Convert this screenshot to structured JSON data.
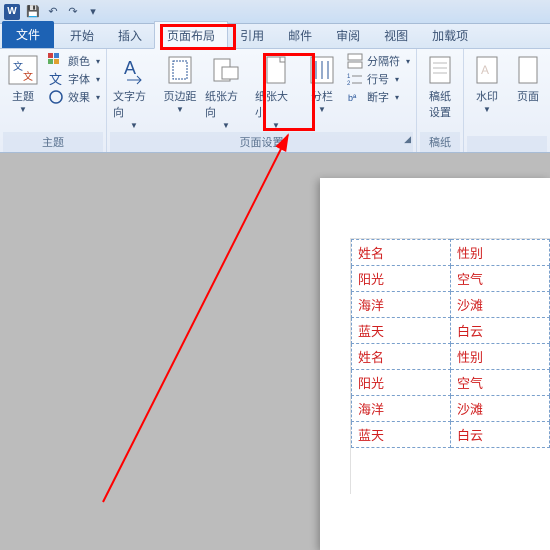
{
  "qat": {
    "save": "💾",
    "undo": "↶",
    "redo": "↷"
  },
  "tabs": {
    "file": "文件",
    "items": [
      "开始",
      "插入",
      "页面布局",
      "引用",
      "邮件",
      "审阅",
      "视图",
      "加载项"
    ],
    "active_index": 2
  },
  "ribbon": {
    "theme": {
      "label": "主题",
      "theme_btn": "主题",
      "color": "颜色",
      "font": "字体",
      "effect": "效果"
    },
    "page_setup": {
      "label": "页面设置",
      "text_dir": "文字方向",
      "margins": "页边距",
      "orientation": "纸张方向",
      "size": "纸张大小",
      "columns": "分栏",
      "breaks": "分隔符",
      "line_no": "行号",
      "hyphen": "断字"
    },
    "draft": {
      "label": "稿纸",
      "btn": "稿纸",
      "btn2": "设置"
    },
    "watermark": {
      "btn": "水印"
    },
    "page_bg": {
      "btn": "页面"
    }
  },
  "table": {
    "rows": [
      [
        "姓名",
        "性别"
      ],
      [
        "阳光",
        "空气"
      ],
      [
        "海洋",
        "沙滩"
      ],
      [
        "蓝天",
        "白云"
      ],
      [
        "姓名",
        "性别"
      ],
      [
        "阳光",
        "空气"
      ],
      [
        "海洋",
        "沙滩"
      ],
      [
        "蓝天",
        "白云"
      ]
    ]
  }
}
